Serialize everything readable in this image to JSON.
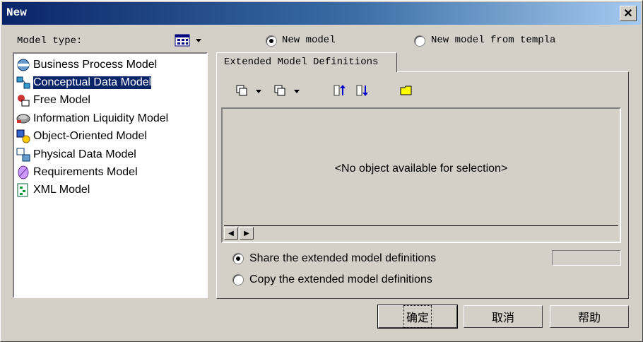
{
  "window": {
    "title": "New"
  },
  "left": {
    "model_type_label": "Model type:",
    "items": [
      {
        "label": "Business Process Model",
        "icon": "business-process-icon"
      },
      {
        "label": "Conceptual Data Model",
        "icon": "conceptual-data-icon",
        "selected": true
      },
      {
        "label": "Free Model",
        "icon": "free-model-icon"
      },
      {
        "label": "Information Liquidity Model",
        "icon": "information-liquidity-icon"
      },
      {
        "label": "Object-Oriented Model",
        "icon": "object-oriented-icon"
      },
      {
        "label": "Physical Data Model",
        "icon": "physical-data-icon"
      },
      {
        "label": "Requirements Model",
        "icon": "requirements-icon"
      },
      {
        "label": "XML Model",
        "icon": "xml-model-icon"
      }
    ]
  },
  "options": {
    "new_model_label": "New model",
    "new_from_template_label": "New model from templa",
    "selected": "new_model"
  },
  "tab": {
    "label": "Extended Model Definitions"
  },
  "grid": {
    "empty_message": "<No object available for selection>"
  },
  "share": {
    "share_label": "Share the extended model definitions",
    "copy_label": "Copy the extended model definitions",
    "selected": "share"
  },
  "buttons": {
    "ok": "确定",
    "cancel": "取消",
    "help": "帮助"
  },
  "colors": {
    "title_start": "#0a246a",
    "title_end": "#a6caf0",
    "selection": "#0a246a",
    "face": "#d4d0c8"
  }
}
